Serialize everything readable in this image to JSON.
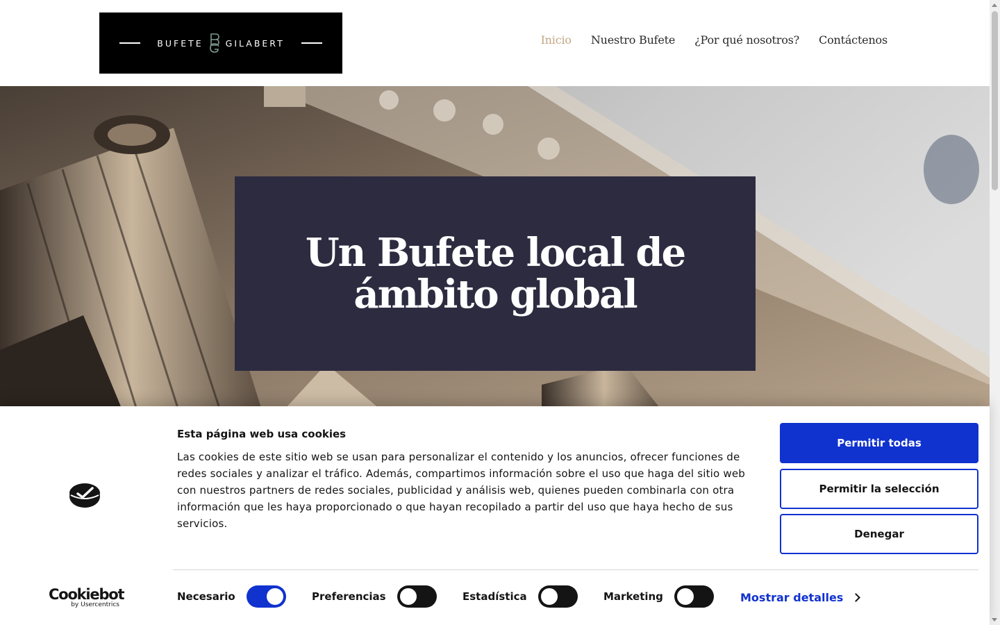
{
  "header": {
    "logo": {
      "left_word": "BUFETE",
      "right_word": "GILABERT",
      "monogram": "BG"
    },
    "nav": [
      {
        "label": "Inicio",
        "active": true
      },
      {
        "label": "Nuestro Bufete",
        "active": false
      },
      {
        "label": "¿Por qué nosotros?",
        "active": false
      },
      {
        "label": "Contáctenos",
        "active": false
      }
    ]
  },
  "hero": {
    "title": "Un Bufete local de ámbito global",
    "box_color": "#2d2b40"
  },
  "cookie": {
    "title": "Esta página web usa cookies",
    "text": "Las cookies de este sitio web se usan para personalizar el contenido y los anuncios, ofrecer funciones de redes sociales y analizar el tráfico. Además, compartimos información sobre el uso que haga del sitio web con nuestros partners de redes sociales, publicidad y análisis web, quienes pueden combinarla con otra información que les haya proporcionado o que hayan recopilado a partir del uso que haya hecho de sus servicios.",
    "buttons": {
      "allow_all": "Permitir todas",
      "allow_selection": "Permitir la selección",
      "deny": "Denegar"
    },
    "toggles": [
      {
        "label": "Necesario",
        "on": true
      },
      {
        "label": "Preferencias",
        "on": false
      },
      {
        "label": "Estadística",
        "on": false
      },
      {
        "label": "Marketing",
        "on": false
      }
    ],
    "details_link": "Mostrar detalles",
    "brand": {
      "name": "Cookiebot",
      "sub": "by Usercentrics"
    },
    "accent_color": "#1032cf"
  },
  "colors": {
    "nav_active": "#c3a683",
    "text": "#141414"
  }
}
